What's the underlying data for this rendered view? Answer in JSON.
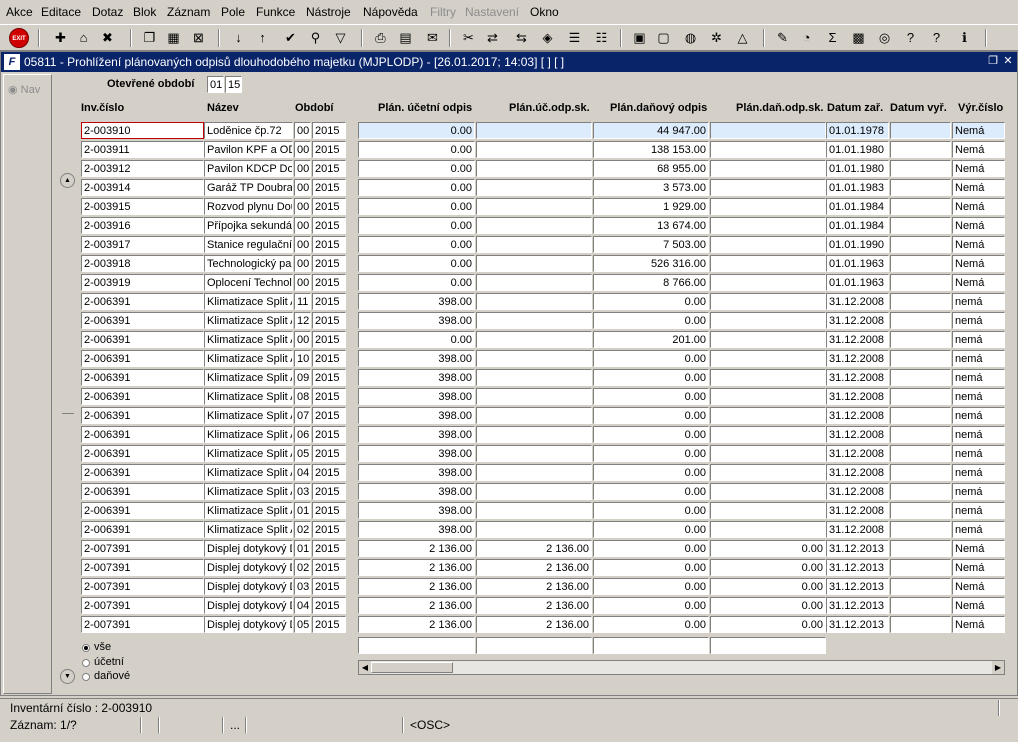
{
  "menu": [
    "Akce",
    "Editace",
    "Dotaz",
    "Blok",
    "Záznam",
    "Pole",
    "Funkce",
    "Nástroje",
    "Nápověda",
    "Filtry",
    "Nastavení",
    "Okno"
  ],
  "menu_disabled": [
    9,
    10
  ],
  "toolbar": {
    "exit_label": "EXIT"
  },
  "window": {
    "title": "05811 - Prohlížení plánovaných odpisů dlouhodobého majetku (MJPLODP) - [26.01.2017; 14:03]  [ ]  [ ]"
  },
  "nav": {
    "label": "Nav"
  },
  "period": {
    "label": "Otevřené období",
    "month": "01",
    "year": "15"
  },
  "columns": {
    "inv": "Inv.číslo",
    "name": "Název",
    "period": "Období",
    "plan_ucet": "Plán. účetní odpis",
    "plan_uc_sk": "Plán.úč.odp.sk.",
    "plan_dan": "Plán.daňový odpis",
    "plan_dan_sk": "Plán.daň.odp.sk.",
    "datum_zar": "Datum zař.",
    "datum_vyr": "Datum vyř.",
    "vyr_cislo": "Výr.číslo"
  },
  "rows": [
    {
      "inv": "2-003910",
      "name": "Loděnice čp.72",
      "mm": "00",
      "yy": "2015",
      "ucet": "0.00",
      "uc_sk": "",
      "dan": "44 947.00",
      "dan_sk": "",
      "zar": "01.01.1978",
      "vyr": "",
      "cislo": "Nemá"
    },
    {
      "inv": "2-003911",
      "name": "Pavilon KPF a ODO",
      "mm": "00",
      "yy": "2015",
      "ucet": "0.00",
      "uc_sk": "",
      "dan": "138 153.00",
      "dan_sk": "",
      "zar": "01.01.1980",
      "vyr": "",
      "cislo": "Nemá"
    },
    {
      "inv": "2-003912",
      "name": "Pavilon KDCP Dou",
      "mm": "00",
      "yy": "2015",
      "ucet": "0.00",
      "uc_sk": "",
      "dan": "68 955.00",
      "dan_sk": "",
      "zar": "01.01.1980",
      "vyr": "",
      "cislo": "Nemá"
    },
    {
      "inv": "2-003914",
      "name": "Garáž TP Doubrav",
      "mm": "00",
      "yy": "2015",
      "ucet": "0.00",
      "uc_sk": "",
      "dan": "3 573.00",
      "dan_sk": "",
      "zar": "01.01.1983",
      "vyr": "",
      "cislo": "Nemá"
    },
    {
      "inv": "2-003915",
      "name": "Rozvod plynu Dou",
      "mm": "00",
      "yy": "2015",
      "ucet": "0.00",
      "uc_sk": "",
      "dan": "1 929.00",
      "dan_sk": "",
      "zar": "01.01.1984",
      "vyr": "",
      "cislo": "Nemá"
    },
    {
      "inv": "2-003916",
      "name": "Přípojka sekundár",
      "mm": "00",
      "yy": "2015",
      "ucet": "0.00",
      "uc_sk": "",
      "dan": "13 674.00",
      "dan_sk": "",
      "zar": "01.01.1984",
      "vyr": "",
      "cislo": "Nemá"
    },
    {
      "inv": "2-003917",
      "name": "Stanice regulační",
      "mm": "00",
      "yy": "2015",
      "ucet": "0.00",
      "uc_sk": "",
      "dan": "7 503.00",
      "dan_sk": "",
      "zar": "01.01.1990",
      "vyr": "",
      "cislo": "Nemá"
    },
    {
      "inv": "2-003918",
      "name": "Technologický pa",
      "mm": "00",
      "yy": "2015",
      "ucet": "0.00",
      "uc_sk": "",
      "dan": "526 316.00",
      "dan_sk": "",
      "zar": "01.01.1963",
      "vyr": "",
      "cislo": "Nemá"
    },
    {
      "inv": "2-003919",
      "name": "Oplocení Technolo",
      "mm": "00",
      "yy": "2015",
      "ucet": "0.00",
      "uc_sk": "",
      "dan": "8 766.00",
      "dan_sk": "",
      "zar": "01.01.1963",
      "vyr": "",
      "cislo": "Nemá"
    },
    {
      "inv": "2-006391",
      "name": "Klimatizace Split A",
      "mm": "11",
      "yy": "2015",
      "ucet": "398.00",
      "uc_sk": "",
      "dan": "0.00",
      "dan_sk": "",
      "zar": "31.12.2008",
      "vyr": "",
      "cislo": "nemá"
    },
    {
      "inv": "2-006391",
      "name": "Klimatizace Split A",
      "mm": "12",
      "yy": "2015",
      "ucet": "398.00",
      "uc_sk": "",
      "dan": "0.00",
      "dan_sk": "",
      "zar": "31.12.2008",
      "vyr": "",
      "cislo": "nemá"
    },
    {
      "inv": "2-006391",
      "name": "Klimatizace Split A",
      "mm": "00",
      "yy": "2015",
      "ucet": "0.00",
      "uc_sk": "",
      "dan": "201.00",
      "dan_sk": "",
      "zar": "31.12.2008",
      "vyr": "",
      "cislo": "nemá"
    },
    {
      "inv": "2-006391",
      "name": "Klimatizace Split A",
      "mm": "10",
      "yy": "2015",
      "ucet": "398.00",
      "uc_sk": "",
      "dan": "0.00",
      "dan_sk": "",
      "zar": "31.12.2008",
      "vyr": "",
      "cislo": "nemá"
    },
    {
      "inv": "2-006391",
      "name": "Klimatizace Split A",
      "mm": "09",
      "yy": "2015",
      "ucet": "398.00",
      "uc_sk": "",
      "dan": "0.00",
      "dan_sk": "",
      "zar": "31.12.2008",
      "vyr": "",
      "cislo": "nemá"
    },
    {
      "inv": "2-006391",
      "name": "Klimatizace Split A",
      "mm": "08",
      "yy": "2015",
      "ucet": "398.00",
      "uc_sk": "",
      "dan": "0.00",
      "dan_sk": "",
      "zar": "31.12.2008",
      "vyr": "",
      "cislo": "nemá"
    },
    {
      "inv": "2-006391",
      "name": "Klimatizace Split A",
      "mm": "07",
      "yy": "2015",
      "ucet": "398.00",
      "uc_sk": "",
      "dan": "0.00",
      "dan_sk": "",
      "zar": "31.12.2008",
      "vyr": "",
      "cislo": "nemá"
    },
    {
      "inv": "2-006391",
      "name": "Klimatizace Split A",
      "mm": "06",
      "yy": "2015",
      "ucet": "398.00",
      "uc_sk": "",
      "dan": "0.00",
      "dan_sk": "",
      "zar": "31.12.2008",
      "vyr": "",
      "cislo": "nemá"
    },
    {
      "inv": "2-006391",
      "name": "Klimatizace Split A",
      "mm": "05",
      "yy": "2015",
      "ucet": "398.00",
      "uc_sk": "",
      "dan": "0.00",
      "dan_sk": "",
      "zar": "31.12.2008",
      "vyr": "",
      "cislo": "nemá"
    },
    {
      "inv": "2-006391",
      "name": "Klimatizace Split A",
      "mm": "04",
      "yy": "2015",
      "ucet": "398.00",
      "uc_sk": "",
      "dan": "0.00",
      "dan_sk": "",
      "zar": "31.12.2008",
      "vyr": "",
      "cislo": "nemá"
    },
    {
      "inv": "2-006391",
      "name": "Klimatizace Split A",
      "mm": "03",
      "yy": "2015",
      "ucet": "398.00",
      "uc_sk": "",
      "dan": "0.00",
      "dan_sk": "",
      "zar": "31.12.2008",
      "vyr": "",
      "cislo": "nemá"
    },
    {
      "inv": "2-006391",
      "name": "Klimatizace Split A",
      "mm": "01",
      "yy": "2015",
      "ucet": "398.00",
      "uc_sk": "",
      "dan": "0.00",
      "dan_sk": "",
      "zar": "31.12.2008",
      "vyr": "",
      "cislo": "nemá"
    },
    {
      "inv": "2-006391",
      "name": "Klimatizace Split A",
      "mm": "02",
      "yy": "2015",
      "ucet": "398.00",
      "uc_sk": "",
      "dan": "0.00",
      "dan_sk": "",
      "zar": "31.12.2008",
      "vyr": "",
      "cislo": "nemá"
    },
    {
      "inv": "2-007391",
      "name": "Displej dotykový D",
      "mm": "01",
      "yy": "2015",
      "ucet": "2 136.00",
      "uc_sk": "2 136.00",
      "dan": "0.00",
      "dan_sk": "0.00",
      "zar": "31.12.2013",
      "vyr": "",
      "cislo": "Nemá"
    },
    {
      "inv": "2-007391",
      "name": "Displej dotykový D",
      "mm": "02",
      "yy": "2015",
      "ucet": "2 136.00",
      "uc_sk": "2 136.00",
      "dan": "0.00",
      "dan_sk": "0.00",
      "zar": "31.12.2013",
      "vyr": "",
      "cislo": "Nemá"
    },
    {
      "inv": "2-007391",
      "name": "Displej dotykový D",
      "mm": "03",
      "yy": "2015",
      "ucet": "2 136.00",
      "uc_sk": "2 136.00",
      "dan": "0.00",
      "dan_sk": "0.00",
      "zar": "31.12.2013",
      "vyr": "",
      "cislo": "Nemá"
    },
    {
      "inv": "2-007391",
      "name": "Displej dotykový D",
      "mm": "04",
      "yy": "2015",
      "ucet": "2 136.00",
      "uc_sk": "2 136.00",
      "dan": "0.00",
      "dan_sk": "0.00",
      "zar": "31.12.2013",
      "vyr": "",
      "cislo": "Nemá"
    },
    {
      "inv": "2-007391",
      "name": "Displej dotykový D",
      "mm": "05",
      "yy": "2015",
      "ucet": "2 136.00",
      "uc_sk": "2 136.00",
      "dan": "0.00",
      "dan_sk": "0.00",
      "zar": "31.12.2013",
      "vyr": "",
      "cislo": "Nemá"
    }
  ],
  "filter": {
    "options": [
      "vše",
      "účetní",
      "daňové"
    ],
    "selected": 0
  },
  "status": {
    "line1": "Inventární číslo : 2-003910",
    "record": "Záznam: 1/?",
    "dots": "...",
    "osc": "<OSC>"
  }
}
